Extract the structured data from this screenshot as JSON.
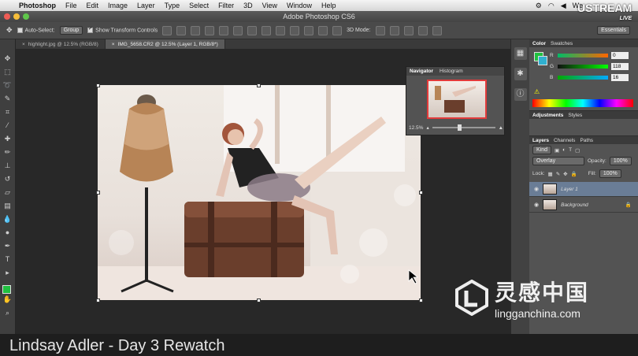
{
  "menubar": {
    "app": "Photoshop",
    "items": [
      "File",
      "Edit",
      "Image",
      "Layer",
      "Type",
      "Select",
      "Filter",
      "3D",
      "View",
      "Window",
      "Help"
    ],
    "user_truncated": "We"
  },
  "window": {
    "title": "Adobe Photoshop CS6"
  },
  "options_bar": {
    "auto_select_label": "Auto-Select:",
    "auto_select_value": "Group",
    "show_transform_label": "Show Transform Controls",
    "mode_label": "3D Mode:",
    "workspace": "Essentials"
  },
  "tabs": [
    {
      "label": "highlight.jpg @ 12.5% (RGB/8)",
      "active": false
    },
    {
      "label": "IMG_5658.CR2 @ 12.5% (Layer 1, RGB/8*)",
      "active": true
    }
  ],
  "navigator": {
    "tabs": [
      "Navigator",
      "Histogram"
    ],
    "zoom": "12.5%"
  },
  "color_panel": {
    "tabs": [
      "Color",
      "Swatches"
    ],
    "fg_color": "#20c040",
    "channels": [
      {
        "label": "R",
        "value": "0"
      },
      {
        "label": "G",
        "value": "118"
      },
      {
        "label": "B",
        "value": "16"
      }
    ]
  },
  "adjustments": {
    "tabs": [
      "Adjustments",
      "Styles"
    ]
  },
  "layers_panel": {
    "tabs": [
      "Layers",
      "Channels",
      "Paths"
    ],
    "kind": "Kind",
    "blend_mode": "Overlay",
    "opacity_label": "Opacity:",
    "opacity": "100%",
    "lock_label": "Lock:",
    "fill_label": "Fill:",
    "fill": "100%",
    "layers": [
      {
        "name": "Layer 1",
        "selected": true
      },
      {
        "name": "Background",
        "selected": false
      }
    ]
  },
  "overlay": {
    "caption": "Lindsay Adler - Day 3 Rewatch",
    "ustream": "USTREAM",
    "ustream_live": "LIVE",
    "watermark_cn": "灵感中国",
    "watermark_url": "lingganchina.com"
  }
}
